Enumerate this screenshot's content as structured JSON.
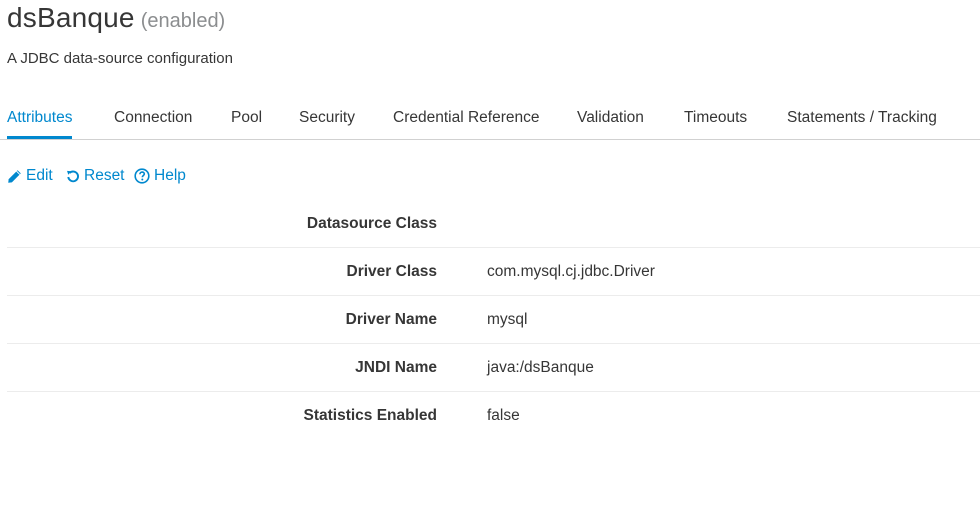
{
  "header": {
    "title": "dsBanque",
    "status": "(enabled)",
    "subtitle": "A JDBC data-source configuration"
  },
  "tabs": [
    {
      "label": "Attributes",
      "active": true
    },
    {
      "label": "Connection",
      "active": false
    },
    {
      "label": "Pool",
      "active": false
    },
    {
      "label": "Security",
      "active": false
    },
    {
      "label": "Credential Reference",
      "active": false
    },
    {
      "label": "Validation",
      "active": false
    },
    {
      "label": "Timeouts",
      "active": false
    },
    {
      "label": "Statements / Tracking",
      "active": false
    }
  ],
  "toolbar": {
    "edit_label": "Edit",
    "edit_icon": "pencil-icon",
    "reset_label": "Reset",
    "reset_icon": "undo-icon",
    "help_label": "Help",
    "help_icon": "question-circle-icon"
  },
  "attributes": [
    {
      "label": "Datasource Class",
      "value": ""
    },
    {
      "label": "Driver Class",
      "value": "com.mysql.cj.jdbc.Driver"
    },
    {
      "label": "Driver Name",
      "value": "mysql"
    },
    {
      "label": "JNDI Name",
      "value": "java:/dsBanque"
    },
    {
      "label": "Statistics Enabled",
      "value": "false"
    }
  ],
  "colors": {
    "accent": "#0088ce",
    "text": "#363636",
    "muted": "#8b8d8f",
    "divider": "#d1d1d1"
  }
}
